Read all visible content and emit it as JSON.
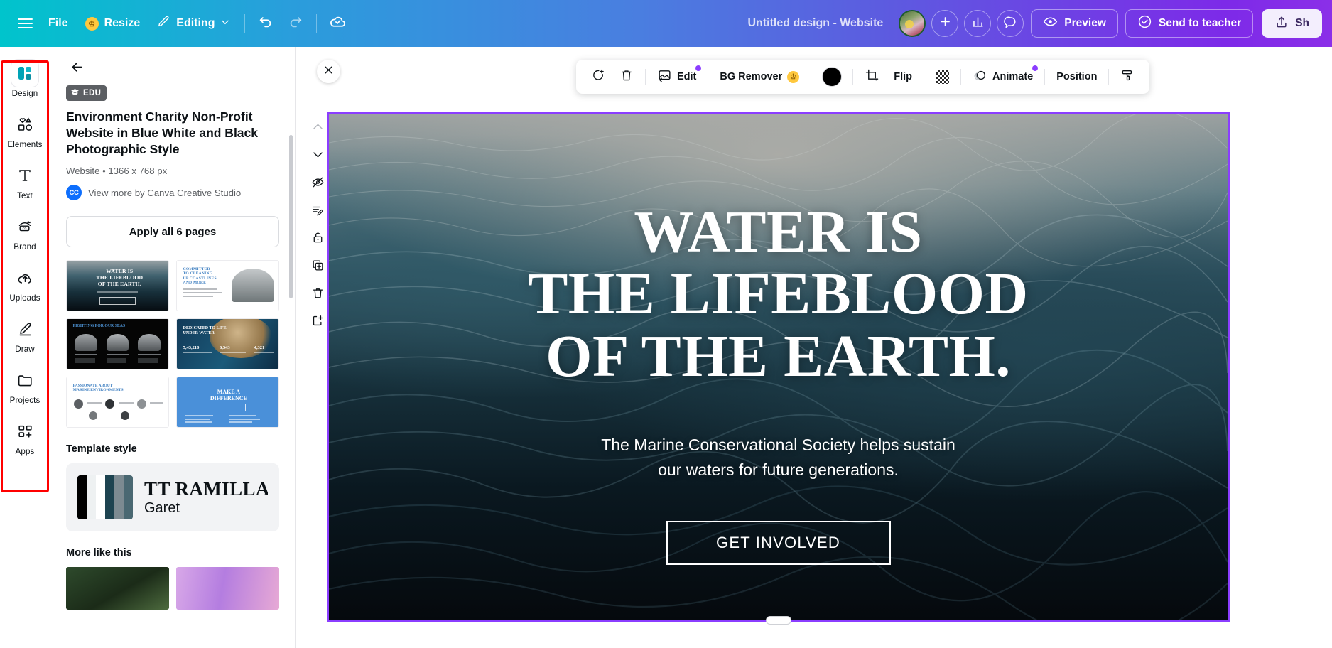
{
  "topbar": {
    "menu_icon": "hamburger-icon",
    "file_label": "File",
    "resize_label": "Resize",
    "editing_label": "Editing",
    "undo_icon": "undo-icon",
    "redo_icon": "redo-icon",
    "cloud_icon": "cloud-saved-icon",
    "doc_title": "Untitled design - Website",
    "add_icon": "plus-icon",
    "insights_icon": "bar-chart-icon",
    "comment_icon": "comment-bubble-icon",
    "preview_label": "Preview",
    "preview_icon": "eye-icon",
    "send_label": "Send to teacher",
    "send_icon": "check-circle-icon",
    "share_label": "Sh",
    "share_icon": "share-upload-icon"
  },
  "rail": {
    "highlight_color": "#ff0000",
    "items": [
      {
        "label": "Design",
        "icon": "design-grid-icon",
        "active": true
      },
      {
        "label": "Elements",
        "icon": "shapes-icon",
        "active": false
      },
      {
        "label": "Text",
        "icon": "text-t-icon",
        "active": false
      },
      {
        "label": "Brand",
        "icon": "brand-crown-icon",
        "active": false
      },
      {
        "label": "Uploads",
        "icon": "upload-cloud-icon",
        "active": false
      },
      {
        "label": "Draw",
        "icon": "pencil-draw-icon",
        "active": false
      },
      {
        "label": "Projects",
        "icon": "folder-icon",
        "active": false
      },
      {
        "label": "Apps",
        "icon": "apps-grid-icon",
        "active": false
      }
    ]
  },
  "panel": {
    "back_icon": "arrow-left-icon",
    "badge": "EDU",
    "badge_icon": "graduation-cap-icon",
    "title": "Environment Charity Non-Profit Website in Blue White and Black Photographic Style",
    "meta": "Website • 1366 x 768 px",
    "author_badge": "CC",
    "author": "View more by Canva Creative Studio",
    "apply_label": "Apply all 6 pages",
    "pages": [
      {
        "name": "page-thumb-1",
        "kind": "water-hero",
        "heading": "WATER IS THE LIFEBLOOD OF THE EARTH."
      },
      {
        "name": "page-thumb-2",
        "kind": "white-photo",
        "heading": "COMMITTED TO CLEANING UP COASTLINES AND MORE"
      },
      {
        "name": "page-thumb-3",
        "kind": "black-trio",
        "heading": "FIGHTING FOR OUR SEAS"
      },
      {
        "name": "page-thumb-4",
        "kind": "deep-stats",
        "heading": "DEDICATED TO LIFE UNDER WATER",
        "stats": [
          "5,43,210",
          "6,543",
          "4,321"
        ]
      },
      {
        "name": "page-thumb-5",
        "kind": "team-white",
        "heading": "PASSIONATE ABOUT MARINE ENVIRONMENTS"
      },
      {
        "name": "page-thumb-6",
        "kind": "blue-cta",
        "heading": "MAKE A DIFFERENCE"
      }
    ],
    "style_heading": "Template style",
    "style_colors": [
      "#000000",
      "#eef1f2",
      "#ffffff",
      "#1d4350",
      "#7c8a91",
      "#4a6872"
    ],
    "style_font_primary": "TT RAMILLAS",
    "style_font_secondary": "Garet",
    "more_heading": "More like this"
  },
  "workspace": {
    "close_icon": "close-x-icon",
    "toolbar": [
      {
        "name": "magic-write-button",
        "label": "",
        "icon": "magic-comment-icon"
      },
      {
        "name": "delete-button",
        "label": "",
        "icon": "trash-icon"
      },
      {
        "name": "edit-image-button",
        "label": "Edit",
        "icon": "image-edit-icon",
        "badge": true
      },
      {
        "name": "bg-remover-button",
        "label": "BG Remover",
        "icon": "",
        "crown": true
      },
      {
        "name": "color-button",
        "label": "",
        "icon": "color-swatch-icon",
        "color": "#000000"
      },
      {
        "name": "crop-button",
        "label": "",
        "icon": "crop-icon"
      },
      {
        "name": "flip-button",
        "label": "Flip",
        "icon": ""
      },
      {
        "name": "transparency-button",
        "label": "",
        "icon": "checker-transparency-icon"
      },
      {
        "name": "animate-button",
        "label": "Animate",
        "icon": "animate-circles-icon",
        "badge": true
      },
      {
        "name": "position-button",
        "label": "Position",
        "icon": ""
      },
      {
        "name": "style-button",
        "label": "",
        "icon": "paint-roller-icon"
      }
    ],
    "page_tools": [
      {
        "name": "move-page-up-button",
        "icon": "chevron-up-icon",
        "dim": true
      },
      {
        "name": "move-page-down-button",
        "icon": "chevron-down-icon",
        "dim": false
      },
      {
        "name": "hide-page-button",
        "icon": "eye-slash-icon",
        "dim": false
      },
      {
        "name": "page-notes-button",
        "icon": "notes-edit-icon",
        "dim": false
      },
      {
        "name": "lock-page-button",
        "icon": "lock-icon",
        "dim": false
      },
      {
        "name": "duplicate-page-button",
        "icon": "duplicate-icon",
        "dim": false
      },
      {
        "name": "delete-page-button",
        "icon": "trash-icon",
        "dim": false
      },
      {
        "name": "add-page-button",
        "icon": "add-page-icon",
        "dim": false
      }
    ],
    "design": {
      "headline_line1": "WATER IS",
      "headline_line2": "THE LIFEBLOOD",
      "headline_line3": "OF THE EARTH.",
      "subhead_line1": "The Marine Conservational Society helps sustain",
      "subhead_line2": "our waters for future generations.",
      "cta_label": "GET INVOLVED",
      "selection_color": "#8b3dff"
    }
  }
}
